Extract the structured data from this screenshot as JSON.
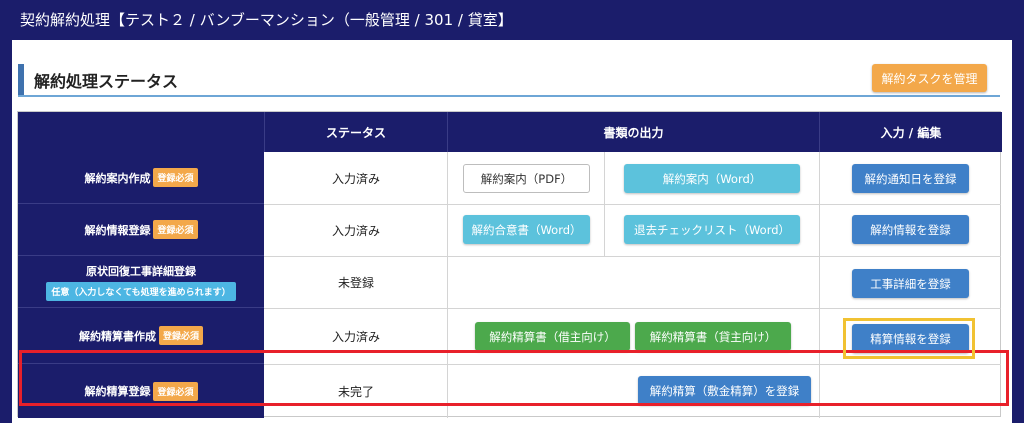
{
  "window": {
    "title": "契約解約処理【テスト２ / バンブーマンション（一般管理 / 301 / 貸室】"
  },
  "section": {
    "title": "解約処理ステータス",
    "manage_button": "解約タスクを管理"
  },
  "table": {
    "headers": {
      "status": "ステータス",
      "documents": "書類の出力",
      "input_edit": "入力 / 編集"
    },
    "rows": [
      {
        "name": "解約案内作成",
        "badge": "登録必須",
        "status": "入力済み",
        "doc_buttons": [
          "解約案内（PDF）",
          "解約案内（Word）"
        ],
        "action": "解約通知日を登録"
      },
      {
        "name": "解約情報登録",
        "badge": "登録必須",
        "status": "入力済み",
        "doc_buttons": [
          "解約合意書（Word）",
          "退去チェックリスト（Word）"
        ],
        "action": "解約情報を登録"
      },
      {
        "name": "原状回復工事詳細登録",
        "badge": "任意（入力しなくても処理を進められます）",
        "status": "未登録",
        "doc_buttons": [],
        "action": "工事詳細を登録"
      },
      {
        "name": "解約精算書作成",
        "badge": "登録必須",
        "status": "入力済み",
        "doc_buttons": [
          "解約精算書（借主向け）",
          "解約精算書（貸主向け）"
        ],
        "action": "精算情報を登録"
      },
      {
        "name": "解約精算登録",
        "badge": "登録必須",
        "status": "未完了",
        "doc_buttons": [],
        "action": "解約精算（敷金精算）を登録"
      }
    ]
  },
  "colors": {
    "navy": "#1b1d6b",
    "orange": "#f3a84a",
    "cyan": "#5cc2dc",
    "blue": "#3f80c8",
    "green": "#4ca94c",
    "highlight_red": "#e8202a",
    "highlight_yellow": "#f1c232"
  }
}
